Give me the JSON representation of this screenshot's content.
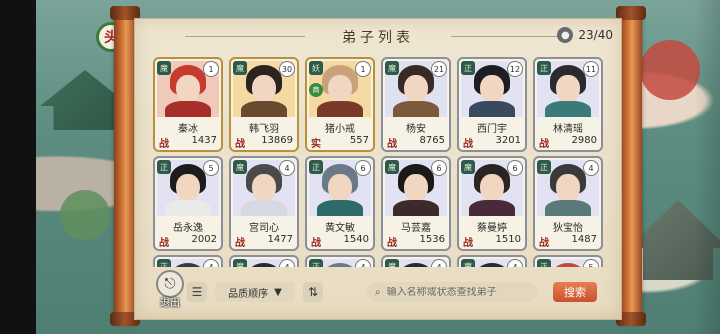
{
  "panel": {
    "title": "弟子列表",
    "count": "23/40"
  },
  "map_marker": {
    "label": "头"
  },
  "disciples": [
    {
      "name": "秦冰",
      "level": "1",
      "stat_label": "战",
      "power": "1437",
      "tier": "gold",
      "sect": "魔",
      "hair": "#c73a2e",
      "bg": "#f1c9b8",
      "body": "#a82e2a"
    },
    {
      "name": "韩飞羽",
      "level": "30",
      "stat_label": "战",
      "power": "13869",
      "tier": "gold",
      "sect": "魔",
      "hair": "#2b2320",
      "bg": "#f4d9a2",
      "body": "#6a4a2e"
    },
    {
      "name": "猪小戒",
      "level": "1",
      "stat_label": "实",
      "power": "557",
      "tier": "gold",
      "sect": "妖",
      "badge": "商",
      "hair": "#c9a27a",
      "bg": "#f4d9a2",
      "body": "#7a3a2a"
    },
    {
      "name": "杨安",
      "level": "21",
      "stat_label": "战",
      "power": "8765",
      "tier": "silver",
      "sect": "魔",
      "hair": "#3a2a24",
      "bg": "#dde1f0",
      "body": "#7a5a3a"
    },
    {
      "name": "西门宇",
      "level": "12",
      "stat_label": "战",
      "power": "3201",
      "tier": "silver",
      "sect": "正",
      "hair": "#1e1e22",
      "bg": "#e2e2f2",
      "body": "#3a4a5e"
    },
    {
      "name": "林清瑶",
      "level": "11",
      "stat_label": "战",
      "power": "2980",
      "tier": "silver",
      "sect": "正",
      "hair": "#2a2a30",
      "bg": "#e2e2f2",
      "body": "#3a7a7a"
    },
    {
      "name": "岳永逸",
      "level": "5",
      "stat_label": "战",
      "power": "2002",
      "tier": "silver",
      "sect": "正",
      "hair": "#1c1c1c",
      "bg": "#e2e2f2",
      "body": "#eaeaea"
    },
    {
      "name": "宫司心",
      "level": "4",
      "stat_label": "战",
      "power": "1477",
      "tier": "silver",
      "sect": "魔",
      "hair": "#4a4a4a",
      "bg": "#e2e2f2",
      "body": "#d8d8e2"
    },
    {
      "name": "黄文敏",
      "level": "6",
      "stat_label": "战",
      "power": "1540",
      "tier": "silver",
      "sect": "正",
      "hair": "#6a7a88",
      "bg": "#e2e2f2",
      "body": "#2e6a6a"
    },
    {
      "name": "马芸嘉",
      "level": "6",
      "stat_label": "战",
      "power": "1536",
      "tier": "silver",
      "sect": "魔",
      "hair": "#1a1a1a",
      "bg": "#e2e2f2",
      "body": "#3a2a2a"
    },
    {
      "name": "蔡曼婷",
      "level": "6",
      "stat_label": "战",
      "power": "1510",
      "tier": "silver",
      "sect": "魔",
      "hair": "#2a2422",
      "bg": "#e2e2f2",
      "body": "#4a2a3a"
    },
    {
      "name": "狄宝怡",
      "level": "4",
      "stat_label": "战",
      "power": "1487",
      "tier": "silver",
      "sect": "正",
      "hair": "#3a3a3a",
      "bg": "#e2e2f2",
      "body": "#5a7a7a"
    },
    {
      "name": "",
      "level": "4",
      "stat_label": "",
      "power": "",
      "tier": "silver",
      "sect": "正",
      "hair": "#3a3a3a",
      "bg": "#e2e2f2",
      "body": "#888"
    },
    {
      "name": "",
      "level": "4",
      "stat_label": "",
      "power": "",
      "tier": "silver",
      "sect": "魔",
      "hair": "#2a2a2a",
      "bg": "#e2e2f2",
      "body": "#888"
    },
    {
      "name": "",
      "level": "4",
      "stat_label": "",
      "power": "",
      "tier": "silver",
      "sect": "正",
      "hair": "#6a7a88",
      "bg": "#e2e2f2",
      "body": "#888"
    },
    {
      "name": "",
      "level": "4",
      "stat_label": "",
      "power": "",
      "tier": "silver",
      "sect": "魔",
      "hair": "#2a2a2a",
      "bg": "#e2e2f2",
      "body": "#888"
    },
    {
      "name": "",
      "level": "4",
      "stat_label": "",
      "power": "",
      "tier": "silver",
      "sect": "魔",
      "hair": "#2a2a2a",
      "bg": "#e2e2f2",
      "body": "#888"
    },
    {
      "name": "",
      "level": "5",
      "stat_label": "",
      "power": "",
      "tier": "silver",
      "sect": "正",
      "hair": "#c44a3a",
      "bg": "#e2e2f2",
      "body": "#888"
    }
  ],
  "toolbar": {
    "exit_label": "退出",
    "sort_label": "品质顺序",
    "search_placeholder": "输入名称或状态查找弟子",
    "search_button": "搜索"
  },
  "icons": {
    "filter": "filter-list-icon",
    "swap": "sort-swap-icon",
    "search": "search-icon",
    "user": "user-count-icon",
    "exit": "exit-icon"
  },
  "colors": {
    "accent": "#c9532d",
    "parchment": "#efe6d2",
    "gold_frame": "#b8913e",
    "silver_frame": "#8b8f99",
    "stat_label": "#9b2a22"
  }
}
